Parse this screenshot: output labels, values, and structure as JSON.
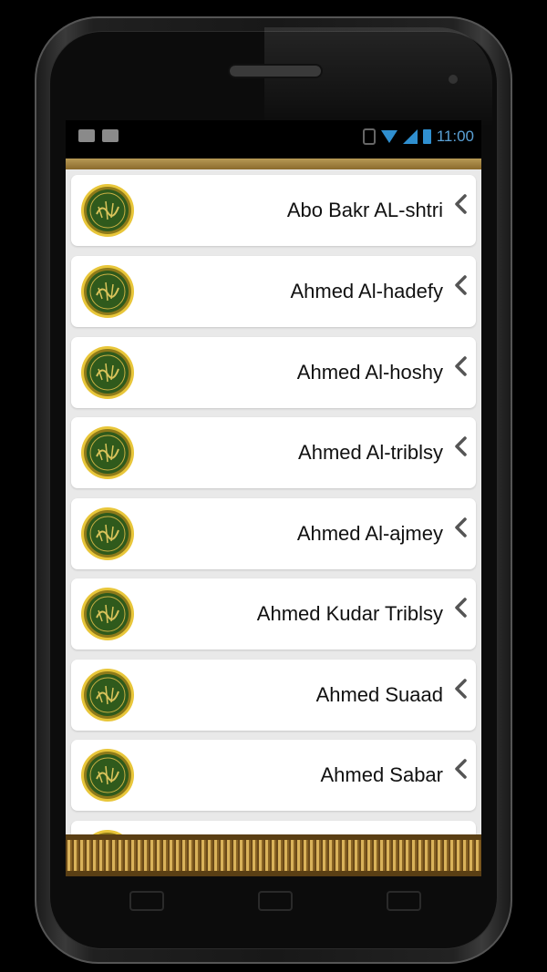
{
  "status_bar": {
    "time": "11:00"
  },
  "reciters": [
    "Abo Bakr AL-shtri",
    "Ahmed Al-hadefy",
    "Ahmed Al-hoshy",
    "Ahmed Al-triblsy",
    "Ahmed Al-ajmey",
    "Ahmed Kudar Triblsy",
    "Ahmed Suaad",
    "Ahmed Sabar"
  ],
  "icons": {
    "item": "quran-emblem-icon",
    "chevron": "chevron-left-icon"
  },
  "colors": {
    "gold": "#b89a55",
    "emblem_green": "#2f5a1c",
    "status_blue": "#2f8fd0"
  }
}
